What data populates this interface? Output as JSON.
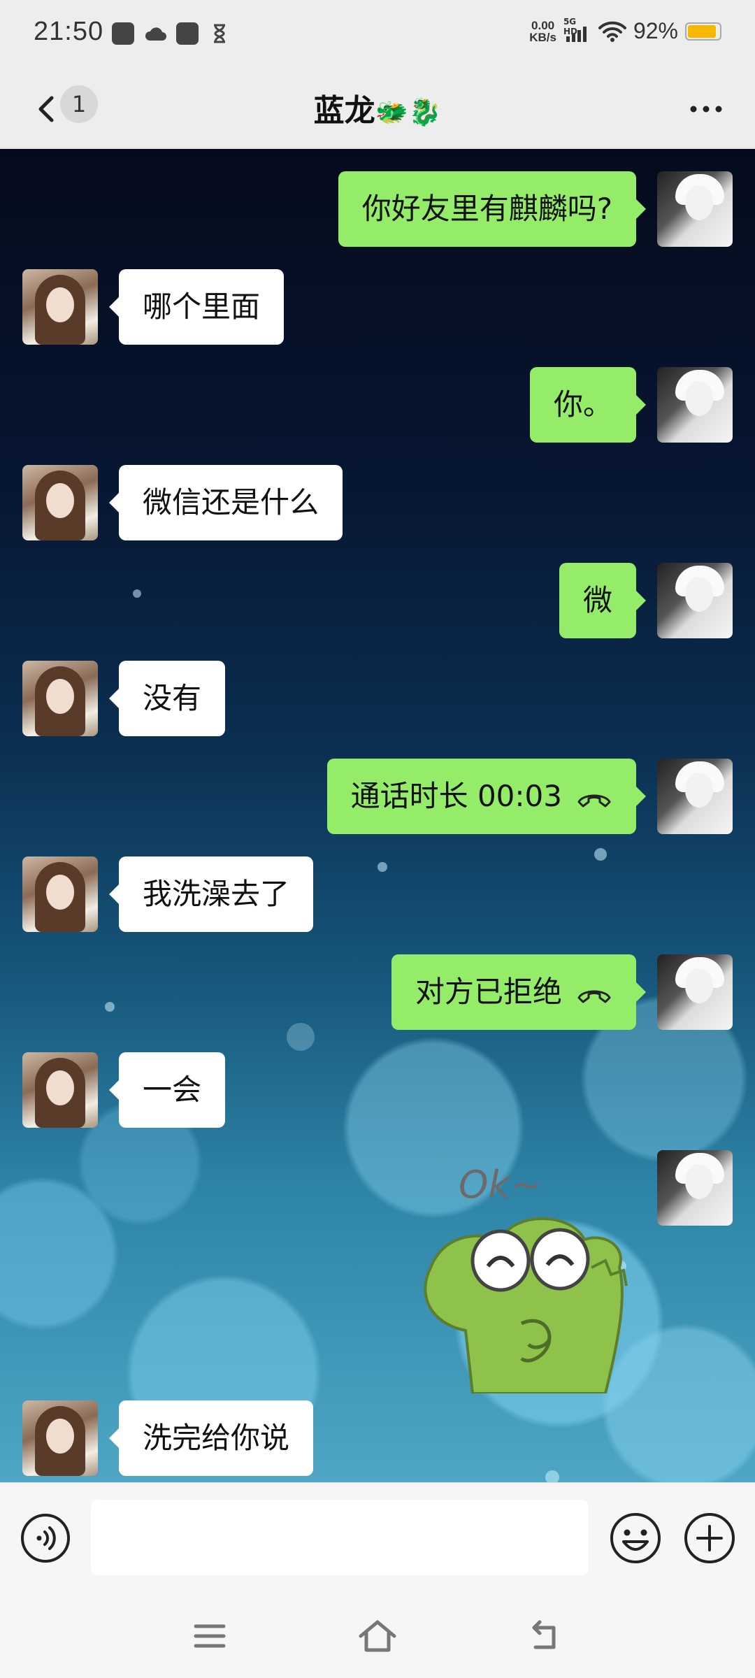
{
  "status_bar": {
    "time": "21:50",
    "net_speed_value": "0.00",
    "net_speed_unit": "KB/s",
    "signal_label": "5G HD",
    "battery_percent": "92%",
    "battery_level": 0.92,
    "icons": [
      "app-icon",
      "cloud-icon",
      "mail-icon",
      "hourglass-icon",
      "signal-icon",
      "wifi-icon",
      "battery-icon"
    ]
  },
  "header": {
    "back_icon": "chevron-left-icon",
    "unread_count": "1",
    "title": "蓝龙",
    "title_emoji": "🐲🐉",
    "more_icon": "more-dots-icon"
  },
  "messages": [
    {
      "side": "me",
      "text": "你好友里有麒麟吗?"
    },
    {
      "side": "her",
      "text": "哪个里面"
    },
    {
      "side": "me",
      "text": "你。"
    },
    {
      "side": "her",
      "text": "微信还是什么"
    },
    {
      "side": "me",
      "text": "微"
    },
    {
      "side": "her",
      "text": "没有"
    },
    {
      "side": "me",
      "text": "通话时长 00:03",
      "icon": "phone-hangup-icon"
    },
    {
      "side": "her",
      "text": "我洗澡去了"
    },
    {
      "side": "me",
      "text": "对方已拒绝",
      "icon": "phone-hangup-icon"
    },
    {
      "side": "her",
      "text": "一会"
    },
    {
      "side": "me",
      "sticker": "frog-ok-sticker",
      "sticker_text": "Ok~"
    },
    {
      "side": "her",
      "text": "洗完给你说"
    }
  ],
  "input_bar": {
    "voice_icon": "voice-icon",
    "text_value": "",
    "emoji_icon": "emoji-icon",
    "plus_icon": "plus-icon"
  },
  "nav_bar": {
    "icons": [
      "menu-icon",
      "home-icon",
      "back-nav-icon"
    ]
  },
  "colors": {
    "my_bubble": "#95ec69",
    "her_bubble": "#ffffff",
    "battery": "#f5b700",
    "chrome": "#ededed"
  }
}
